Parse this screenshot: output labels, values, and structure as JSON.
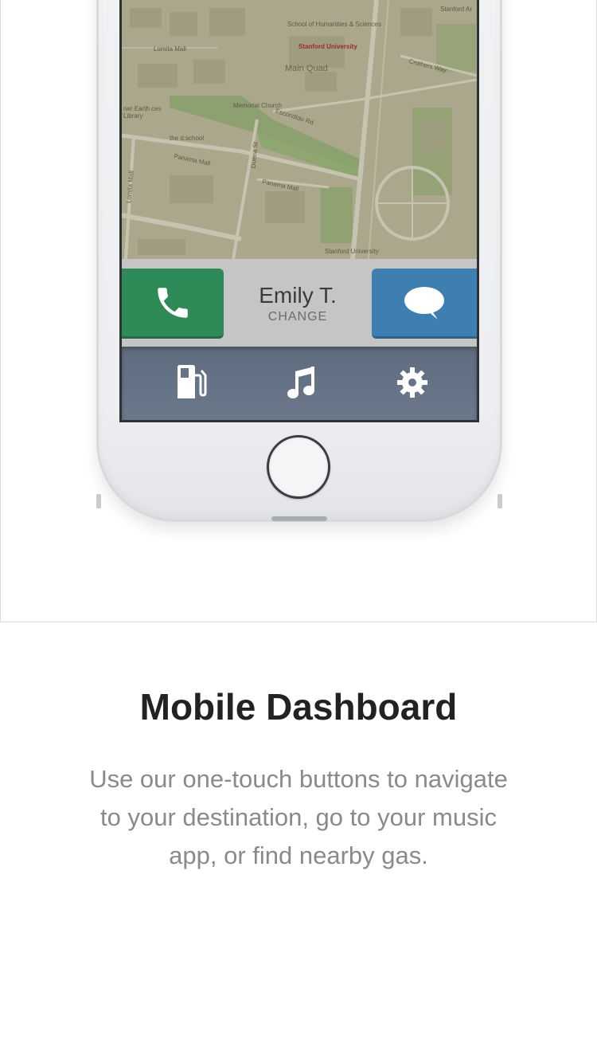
{
  "map": {
    "labels": {
      "humanities": "School of Humanities & Sciences",
      "university": "Stanford University",
      "main_quad": "Main Quad",
      "lomita_mall": "Lomita Mall",
      "memorial_church": "Memorial Church",
      "library": "ner Earth ces Library",
      "dschool": "the d.school",
      "panama_mall_1": "Panama Mall",
      "panama_mall_2": "Panama Mall",
      "escondido": "Escondido Rd",
      "crothers": "Crothers Way",
      "stanford_ar": "Stanford Ar",
      "stanford_univ_bottom": "Stanford University",
      "lomita_mall_v": "Lomita Mall",
      "duena": "Duena St"
    }
  },
  "contact": {
    "name": "Emily T.",
    "change_label": "CHANGE"
  },
  "tabs": {
    "gas": "gas-pump-icon",
    "music": "music-note-icon",
    "settings": "gear-icon"
  },
  "colors": {
    "call": "#2e8a57",
    "message": "#3d7fb0",
    "tabbar": "#66728a"
  },
  "content": {
    "title": "Mobile Dashboard",
    "description": "Use our one-touch buttons to navigate to your destination, go to your music app, or find nearby gas."
  }
}
